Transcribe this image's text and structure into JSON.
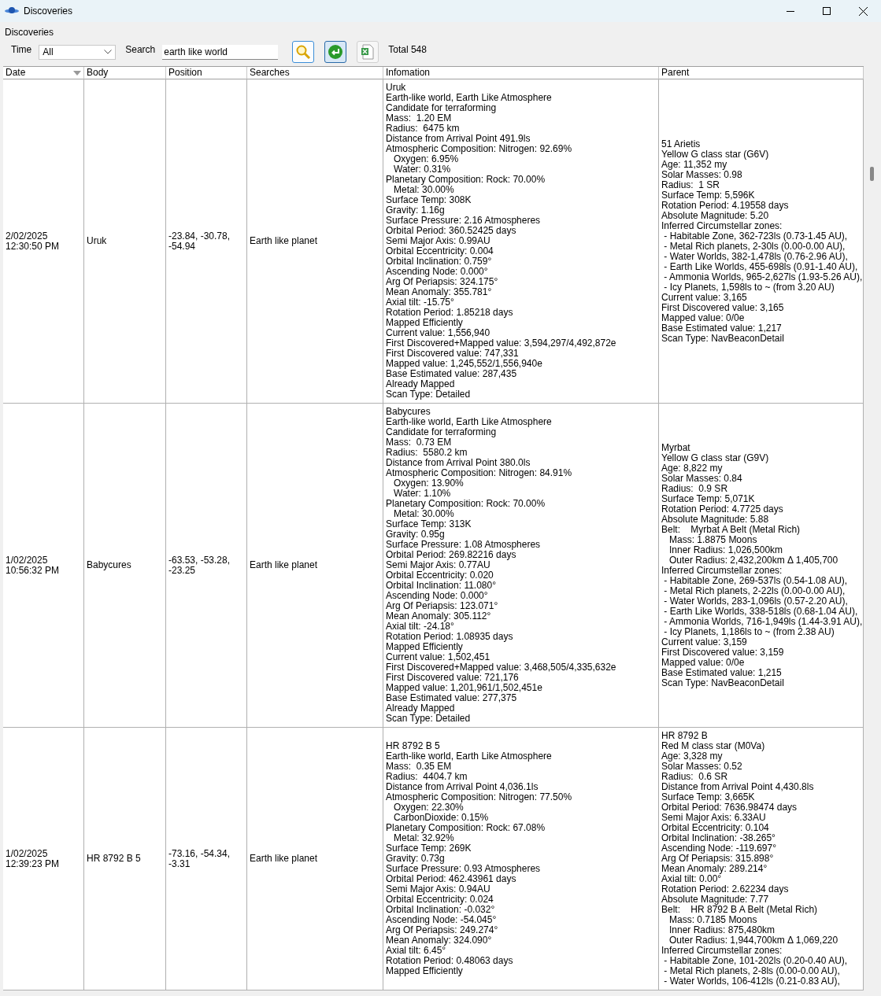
{
  "window": {
    "title": "Discoveries"
  },
  "panel_title": "Discoveries",
  "filters": {
    "time_label": "Time",
    "time_value": "All",
    "search_label": "Search",
    "search_value": "earth like world",
    "total": "Total 548"
  },
  "table": {
    "columns": [
      "Date",
      "Body",
      "Position",
      "Searches",
      "Infomation",
      "Parent"
    ],
    "rows": [
      {
        "date": "2/02/2025\n12:30:50 PM",
        "body": "Uruk",
        "position": "-23.84, -30.78,\n-54.94",
        "searches": "Earth like planet",
        "information": [
          "Uruk",
          "Earth-like world, Earth Like Atmosphere",
          "Candidate for terraforming",
          "Mass:  1.20 EM",
          "Radius:  6475 km",
          "Distance from Arrival Point 491.9ls",
          "Atmospheric Composition: Nitrogen: 92.69%",
          "   Oxygen: 6.95%",
          "   Water: 0.31%",
          "Planetary Composition: Rock: 70.00%",
          "   Metal: 30.00%",
          "Surface Temp: 308K",
          "Gravity: 1.16g",
          "Surface Pressure: 2.16 Atmospheres",
          "Orbital Period: 360.52425 days",
          "Semi Major Axis: 0.99AU",
          "Orbital Eccentricity: 0.004",
          "Orbital Inclination: 0.759°",
          "Ascending Node: 0.000°",
          "Arg Of Periapsis: 324.175°",
          "Mean Anomaly: 355.781°",
          "Axial tilt: -15.75°",
          "Rotation Period: 1.85218 days",
          "Mapped Efficiently",
          "Current value: 1,556,940",
          "First Discovered+Mapped value: 3,594,297/4,492,872e",
          "First Discovered value: 747,331",
          "Mapped value: 1,245,552/1,556,940e",
          "Base Estimated value: 287,435",
          "Already Mapped",
          "Scan Type: Detailed"
        ],
        "parent": [
          "51 Arietis",
          "Yellow G class star (G6V)",
          "Age: 11,352 my",
          "Solar Masses: 0.98",
          "Radius:  1 SR",
          "Surface Temp: 5,596K",
          "Rotation Period: 4.19558 days",
          "Absolute Magnitude: 5.20",
          "Inferred Circumstellar zones:",
          " - Habitable Zone, 362-723ls (0.73-1.45 AU),",
          " - Metal Rich planets, 2-30ls (0.00-0.00 AU),",
          " - Water Worlds, 382-1,478ls (0.76-2.96 AU),",
          " - Earth Like Worlds, 455-698ls (0.91-1.40 AU),",
          " - Ammonia Worlds, 965-2,627ls (1.93-5.26 AU),",
          " - Icy Planets, 1,598ls to ~ (from 3.20 AU)",
          "Current value: 3,165",
          "First Discovered value: 3,165",
          "Mapped value: 0/0e",
          "Base Estimated value: 1,217",
          "Scan Type: NavBeaconDetail"
        ]
      },
      {
        "date": "1/02/2025\n10:56:32 PM",
        "body": "Babycures",
        "position": "-63.53, -53.28,\n-23.25",
        "searches": "Earth like planet",
        "information": [
          "Babycures",
          "Earth-like world, Earth Like Atmosphere",
          "Candidate for terraforming",
          "Mass:  0.73 EM",
          "Radius:  5580.2 km",
          "Distance from Arrival Point 380.0ls",
          "Atmospheric Composition: Nitrogen: 84.91%",
          "   Oxygen: 13.90%",
          "   Water: 1.10%",
          "Planetary Composition: Rock: 70.00%",
          "   Metal: 30.00%",
          "Surface Temp: 313K",
          "Gravity: 0.95g",
          "Surface Pressure: 1.08 Atmospheres",
          "Orbital Period: 269.82216 days",
          "Semi Major Axis: 0.77AU",
          "Orbital Eccentricity: 0.020",
          "Orbital Inclination: 11.080°",
          "Ascending Node: 0.000°",
          "Arg Of Periapsis: 123.071°",
          "Mean Anomaly: 305.112°",
          "Axial tilt: -24.18°",
          "Rotation Period: 1.08935 days",
          "Mapped Efficiently",
          "Current value: 1,502,451",
          "First Discovered+Mapped value: 3,468,505/4,335,632e",
          "First Discovered value: 721,176",
          "Mapped value: 1,201,961/1,502,451e",
          "Base Estimated value: 277,375",
          "Already Mapped",
          "Scan Type: Detailed"
        ],
        "parent": [
          "Myrbat",
          "Yellow G class star (G9V)",
          "Age: 8,822 my",
          "Solar Masses: 0.84",
          "Radius:  0.9 SR",
          "Surface Temp: 5,071K",
          "Rotation Period: 4.7725 days",
          "Absolute Magnitude: 5.88",
          "Belt:    Myrbat A Belt (Metal Rich)",
          "   Mass: 1.8875 Moons",
          "   Inner Radius: 1,026,500km",
          "   Outer Radius: 2,432,200km Δ 1,405,700",
          "Inferred Circumstellar zones:",
          " - Habitable Zone, 269-537ls (0.54-1.08 AU),",
          " - Metal Rich planets, 2-22ls (0.00-0.00 AU),",
          " - Water Worlds, 283-1,096ls (0.57-2.20 AU),",
          " - Earth Like Worlds, 338-518ls (0.68-1.04 AU),",
          " - Ammonia Worlds, 716-1,949ls (1.44-3.91 AU),",
          " - Icy Planets, 1,186ls to ~ (from 2.38 AU)",
          "Current value: 3,159",
          "First Discovered value: 3,159",
          "Mapped value: 0/0e",
          "Base Estimated value: 1,215",
          "Scan Type: NavBeaconDetail"
        ]
      },
      {
        "date": "1/02/2025\n12:39:23 PM",
        "body": "HR 8792 B 5",
        "position": "-73.16, -54.34,\n-3.31",
        "searches": "Earth like planet",
        "information": [
          "HR 8792 B 5",
          "Earth-like world, Earth Like Atmosphere",
          "Mass:  0.35 EM",
          "Radius:  4404.7 km",
          "Distance from Arrival Point 4,036.1ls",
          "Atmospheric Composition: Nitrogen: 77.50%",
          "   Oxygen: 22.30%",
          "   CarbonDioxide: 0.15%",
          "Planetary Composition: Rock: 67.08%",
          "   Metal: 32.92%",
          "Surface Temp: 269K",
          "Gravity: 0.73g",
          "Surface Pressure: 0.93 Atmospheres",
          "Orbital Period: 462.43961 days",
          "Semi Major Axis: 0.94AU",
          "Orbital Eccentricity: 0.024",
          "Orbital Inclination: -0.032°",
          "Ascending Node: -54.045°",
          "Arg Of Periapsis: 249.274°",
          "Mean Anomaly: 324.090°",
          "Axial tilt: 6.45°",
          "Rotation Period: 0.48063 days",
          "Mapped Efficiently"
        ],
        "parent": [
          "HR 8792 B",
          "Red M class star (M0Va)",
          "Age: 3,328 my",
          "Solar Masses: 0.52",
          "Radius:  0.6 SR",
          "Distance from Arrival Point 4,430.8ls",
          "Surface Temp: 3,665K",
          "Orbital Period: 7636.98474 days",
          "Semi Major Axis: 6.33AU",
          "Orbital Eccentricity: 0.104",
          "Orbital Inclination: -38.265°",
          "Ascending Node: -119.697°",
          "Arg Of Periapsis: 315.898°",
          "Mean Anomaly: 289.214°",
          "Axial tilt: 0.00°",
          "Rotation Period: 2.62234 days",
          "Absolute Magnitude: 7.77",
          "Belt:    HR 8792 B A Belt (Metal Rich)",
          "   Mass: 0.7185 Moons",
          "   Inner Radius: 875,480km",
          "   Outer Radius: 1,944,700km Δ 1,069,220",
          "Inferred Circumstellar zones:",
          " - Habitable Zone, 101-202ls (0.20-0.40 AU),",
          " - Metal Rich planets, 2-8ls (0.00-0.00 AU),",
          " - Water Worlds, 106-412ls (0.21-0.83 AU),"
        ]
      }
    ]
  }
}
